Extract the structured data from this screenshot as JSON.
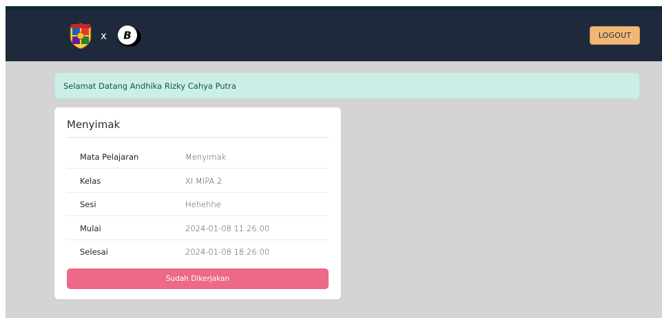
{
  "navbar": {
    "separator": "x",
    "logout_label": "LOGOUT",
    "background": "#1e293b"
  },
  "alert": {
    "message": "Selamat Datang Andhika Rizky Cahya Putra"
  },
  "card": {
    "title": "Menyimak",
    "rows": [
      {
        "label": "Mata Pelajaran",
        "value": "Menyimak"
      },
      {
        "label": "Kelas",
        "value": "XI MIPA 2"
      },
      {
        "label": "Sesi",
        "value": "Hehehhe"
      },
      {
        "label": "Mulai",
        "value": "2024-01-08 11:26:00"
      },
      {
        "label": "Selesai",
        "value": "2024-01-08 18:26:00"
      }
    ],
    "button_label": "Sudah Dikerjakan",
    "button_color": "#ec6a87"
  },
  "icons": {
    "school_logo": "school-crest-icon",
    "partner_logo": "b-logo-icon"
  }
}
